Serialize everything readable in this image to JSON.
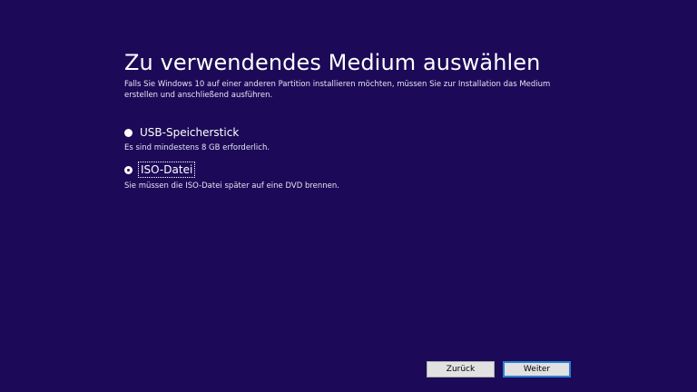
{
  "page": {
    "title": "Zu verwendendes Medium auswählen",
    "description": "Falls Sie Windows 10 auf einer anderen Partition installieren möchten, müssen Sie zur Installation das Medium erstellen und anschließend ausführen."
  },
  "options": [
    {
      "label": "USB-Speicherstick",
      "hint": "Es sind mindestens 8 GB erforderlich.",
      "selected": false
    },
    {
      "label": "ISO-Datei",
      "hint": "Sie müssen die ISO-Datei später auf eine DVD brennen.",
      "selected": true
    }
  ],
  "buttons": {
    "back_label": "Zurück",
    "next_label": "Weiter"
  },
  "colors": {
    "background": "#1c0a58",
    "text": "#ffffff",
    "button_face": "#e1e1e1",
    "focus_border": "#2a7fd4"
  }
}
